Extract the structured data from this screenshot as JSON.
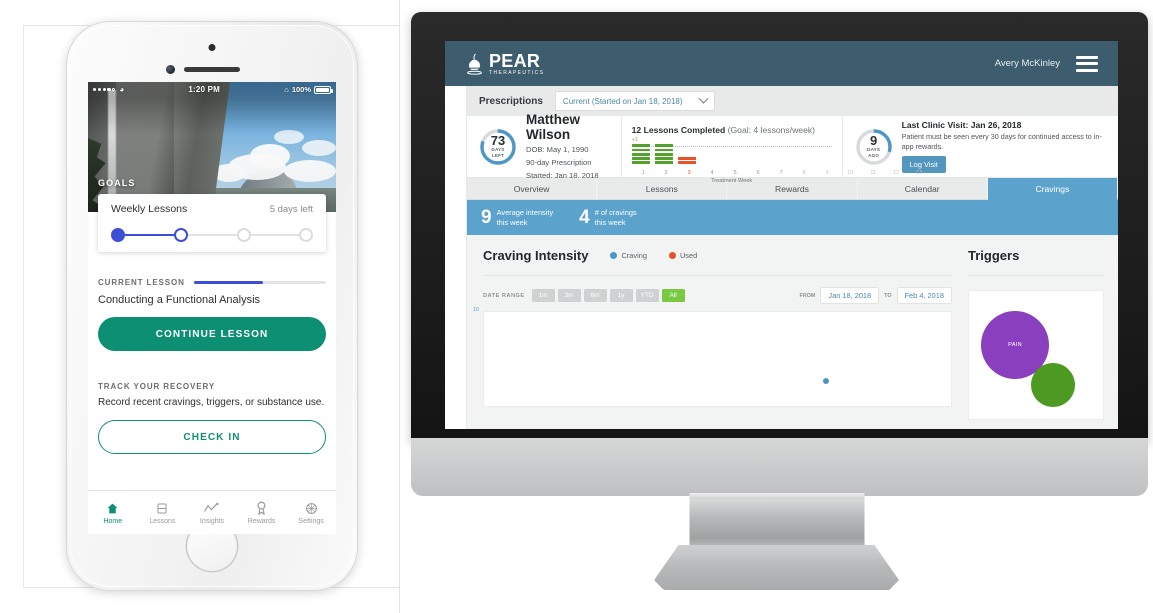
{
  "phone": {
    "status_bar": {
      "time": "1:20 PM",
      "battery": "100%",
      "carrier_dots": 5,
      "wifi_icon": "wifi-icon",
      "bluetooth_icon": "bluetooth-icon"
    },
    "hero_label": "GOALS",
    "goal_card": {
      "title": "Weekly Lessons",
      "remaining": "5 days left",
      "steps_total": 4,
      "steps_completed": 1,
      "current_step": 2
    },
    "current_lesson": {
      "section_label": "CURRENT LESSON",
      "progress_percent": 52,
      "name": "Conducting a Functional Analysis",
      "cta": "CONTINUE LESSON"
    },
    "track_recovery": {
      "section_label": "TRACK YOUR RECOVERY",
      "description": "Record recent cravings, triggers, or substance use.",
      "cta": "CHECK IN"
    },
    "tabs": [
      {
        "label": "Home",
        "icon": "home-icon",
        "active": true
      },
      {
        "label": "Lessons",
        "icon": "book-icon",
        "active": false
      },
      {
        "label": "Insights",
        "icon": "line-chart-icon",
        "active": false
      },
      {
        "label": "Rewards",
        "icon": "medal-icon",
        "active": false
      },
      {
        "label": "Settings",
        "icon": "gear-icon",
        "active": false
      }
    ],
    "accent_teal": "#0d8f74",
    "accent_blue": "#3d4fd6"
  },
  "web": {
    "header": {
      "brand": "PEAR",
      "brand_sub": "THERAPEUTICS",
      "user": "Avery McKinley",
      "menu_icon": "hamburger-icon",
      "bg": "#3d5c6d"
    },
    "prescriptions": {
      "label": "Prescriptions",
      "selected": "Current (Started on Jan 18, 2018)",
      "chevron_icon": "chevron-down-icon"
    },
    "patient": {
      "days_left_number": "73",
      "days_left_line1": "DAYS",
      "days_left_line2": "LEFT",
      "days_left_percent": 81,
      "name": "Matthew Wilson",
      "dob": "DOB: May 1, 1990",
      "prescription": "90-day Prescription",
      "started": "Started: Jan 18, 2018"
    },
    "lessons_widget": {
      "headline_bold": "12 Lessons Completed",
      "headline_rest": " (Goal: 4 lessons/week)",
      "plus_label": "+1",
      "xlabel": "Treatment Week",
      "weeks": [
        "1",
        "2",
        "3",
        "4",
        "5",
        "6",
        "7",
        "8",
        "9",
        "10",
        "11",
        "12",
        "13"
      ],
      "completed_weeks": [
        5,
        5,
        0,
        0,
        0,
        0,
        0,
        0,
        0,
        0,
        0,
        0,
        0
      ],
      "used_weeks": [
        0,
        0,
        2,
        0,
        0,
        0,
        0,
        0,
        0,
        0,
        0,
        0,
        0
      ],
      "highlight_week": "3",
      "color_completed": "#52a22b",
      "color_used": "#e8522a"
    },
    "visit": {
      "days_ago_number": "9",
      "days_ago_line1": "DAYS",
      "days_ago_line2": "AGO",
      "days_ago_percent": 30,
      "title": "Last Clinic Visit: Jan 26, 2018",
      "description": "Patient must be seen every 30 days for continued access to in-app rewards.",
      "button": "Log Visit"
    },
    "tabs": [
      {
        "label": "Overview",
        "active": false
      },
      {
        "label": "Lessons",
        "active": false
      },
      {
        "label": "Rewards",
        "active": false
      },
      {
        "label": "Calendar",
        "active": false
      },
      {
        "label": "Cravings",
        "active": true
      }
    ],
    "stats": [
      {
        "number": "9",
        "line1": "Average intensity",
        "line2": "this week"
      },
      {
        "number": "4",
        "line1": "# of cravings",
        "line2": "this week"
      }
    ],
    "craving": {
      "title": "Craving Intensity",
      "legend": [
        {
          "label": "Craving",
          "color": "#4d97c7"
        },
        {
          "label": "Used",
          "color": "#e8522a"
        }
      ],
      "date_range_label": "DATE RANGE",
      "ranges": [
        {
          "label": "1m",
          "active": false
        },
        {
          "label": "3m",
          "active": false
        },
        {
          "label": "6m",
          "active": false
        },
        {
          "label": "1y",
          "active": false
        },
        {
          "label": "YTD",
          "active": false
        },
        {
          "label": "All",
          "active": true
        }
      ],
      "from_label": "FROM",
      "from_value": "Jan 18, 2018",
      "to_label": "TO",
      "to_value": "Feb 4, 2018",
      "y_axis_top": "10"
    },
    "triggers": {
      "title": "Triggers",
      "bubbles": [
        {
          "label": "PAIN",
          "color": "#8a3fbf"
        },
        {
          "label": "",
          "color": "#4c9a22"
        }
      ]
    },
    "tab_active_color": "#5ba3cc",
    "range_active_color": "#7ac943"
  }
}
